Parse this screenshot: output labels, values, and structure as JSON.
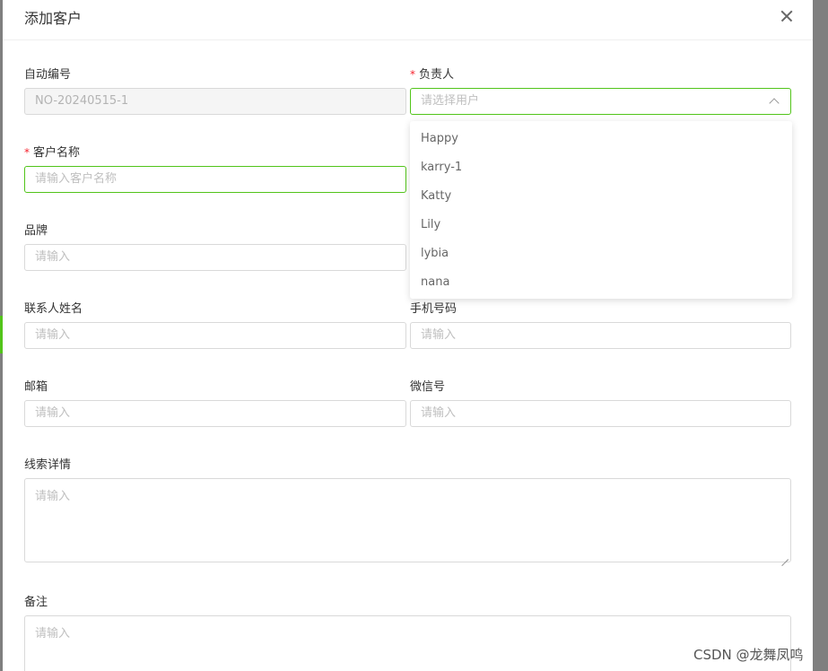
{
  "dialog": {
    "title": "添加客户"
  },
  "form": {
    "auto_number": {
      "label": "自动编号",
      "value": "NO-20240515-1"
    },
    "owner": {
      "required": "*",
      "label": "负责人",
      "placeholder": "请选择用户"
    },
    "customer_name": {
      "required": "*",
      "label": "客户名称",
      "placeholder": "请输入客户名称"
    },
    "brand": {
      "label": "品牌",
      "placeholder": "请输入"
    },
    "contact_name": {
      "label": "联系人姓名",
      "placeholder": "请输入"
    },
    "phone": {
      "label": "手机号码",
      "placeholder": "请输入"
    },
    "email": {
      "label": "邮箱",
      "placeholder": "请输入"
    },
    "wechat": {
      "label": "微信号",
      "placeholder": "请输入"
    },
    "lead_details": {
      "label": "线索详情",
      "placeholder": "请输入"
    },
    "remarks": {
      "label": "备注",
      "placeholder": "请输入"
    }
  },
  "owner_dropdown": {
    "options": [
      "Happy",
      "karry-1",
      "Katty",
      "Lily",
      "lybia",
      "nana"
    ]
  },
  "watermark": "CSDN @龙舞凤鸣",
  "colors": {
    "focus_border": "#52c41a",
    "required_mark": "#f5222d"
  }
}
